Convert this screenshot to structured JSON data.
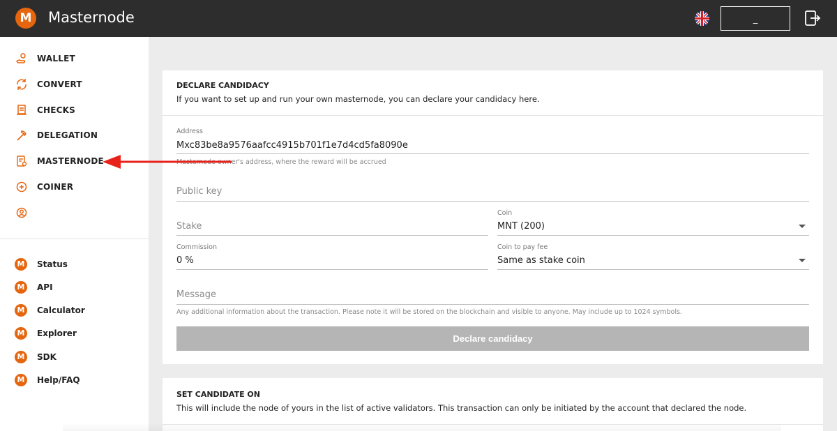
{
  "app": {
    "title": "Masternode",
    "logo_letter": "M"
  },
  "header": {
    "account_text": "_"
  },
  "sidebar": {
    "nav": [
      {
        "label": "WALLET",
        "icon": "wallet-icon"
      },
      {
        "label": "CONVERT",
        "icon": "convert-icon"
      },
      {
        "label": "CHECKS",
        "icon": "checks-icon"
      },
      {
        "label": "DELEGATION",
        "icon": "delegation-icon"
      },
      {
        "label": "MASTERNODE",
        "icon": "masternode-icon"
      },
      {
        "label": "COINER",
        "icon": "coiner-icon"
      },
      {
        "label": "",
        "icon": "user-icon"
      }
    ],
    "links": [
      {
        "label": "Status"
      },
      {
        "label": "API"
      },
      {
        "label": "Calculator"
      },
      {
        "label": "Explorer"
      },
      {
        "label": "SDK"
      },
      {
        "label": "Help/FAQ"
      }
    ]
  },
  "declare": {
    "title": "DECLARE CANDIDACY",
    "description": "If you want to set up and run your own masternode, you can declare your candidacy here.",
    "address_label": "Address",
    "address_value": "Mxc83be8a9576aafcc4915b701f1e7d4cd5fa8090e",
    "address_hint": "Masternode owner's address, where the reward will be accrued",
    "public_key_placeholder": "Public key",
    "stake_placeholder": "Stake",
    "coin_label": "Coin",
    "coin_value": "MNT (200)",
    "commission_label": "Commission",
    "commission_value": "0 %",
    "fee_coin_label": "Coin to pay fee",
    "fee_coin_value": "Same as stake coin",
    "message_placeholder": "Message",
    "message_hint": "Any additional information about the transaction. Please note it will be stored on the blockchain and visible to anyone. May include up to 1024 symbols.",
    "button_label": "Declare candidacy"
  },
  "set_candidate": {
    "title": "SET CANDIDATE ON",
    "description": "This will include the node of yours in the list of active validators. This transaction can only be initiated by the account that declared the node."
  },
  "colors": {
    "accent": "#e6650f",
    "header_bg": "#2d2d2d",
    "annotation_arrow": "#e8221b",
    "button_disabled": "#b5b5b5"
  }
}
